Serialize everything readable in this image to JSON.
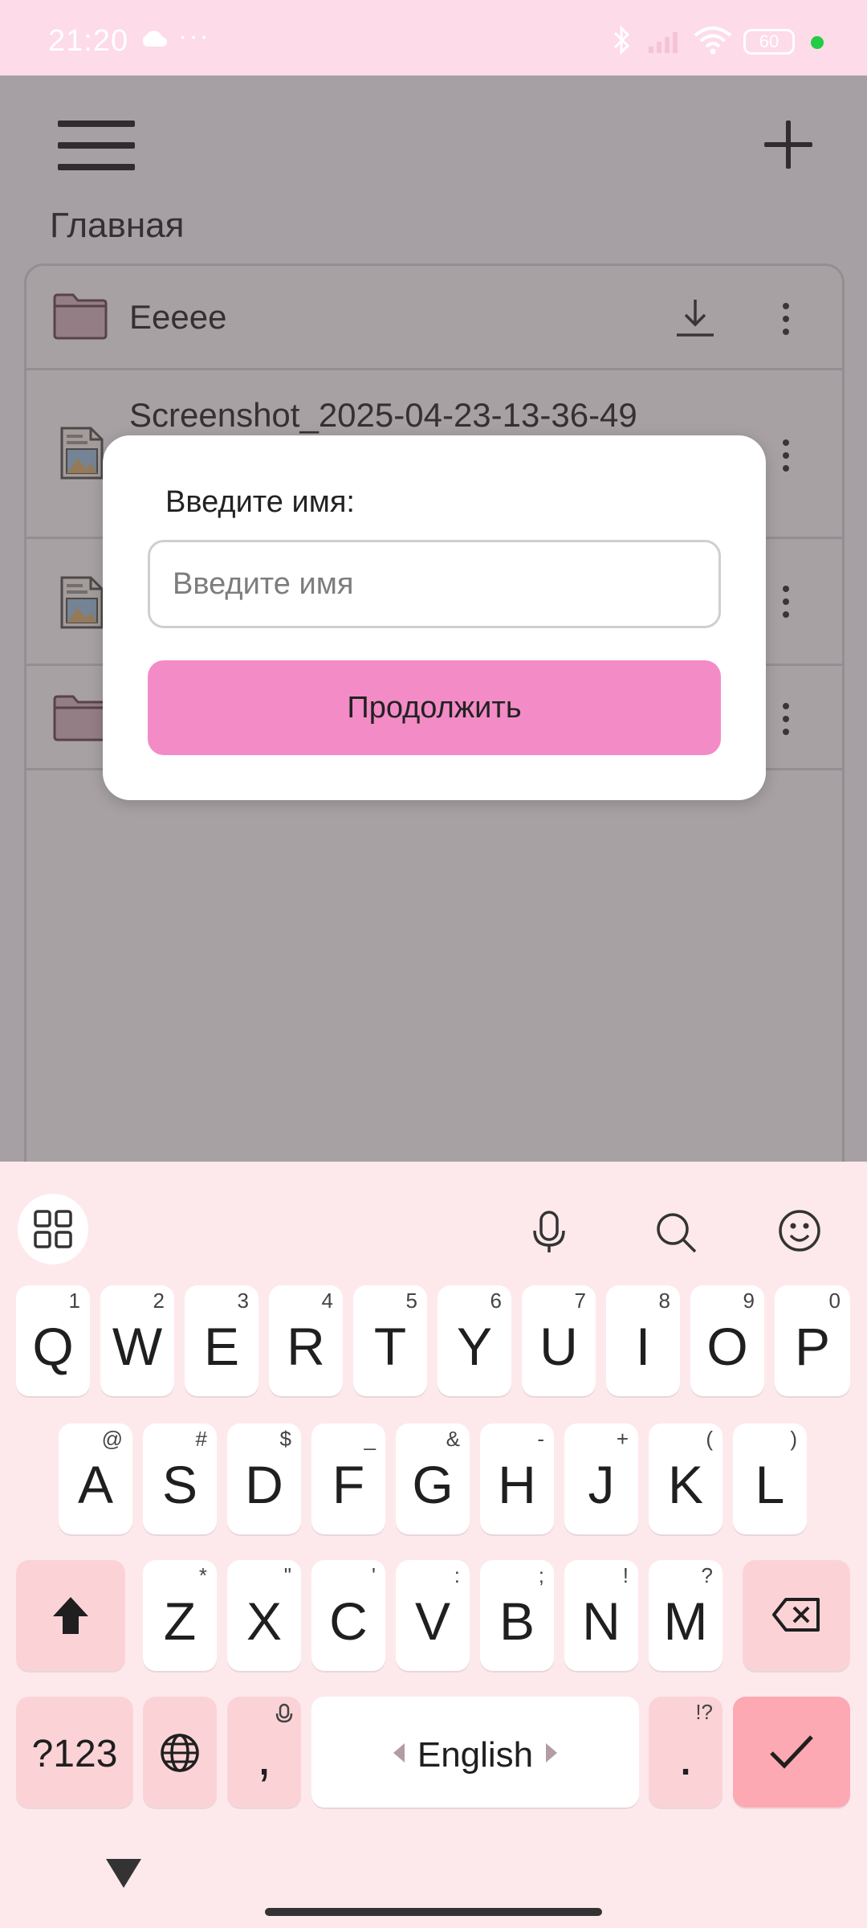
{
  "status_bar": {
    "time": "21:20",
    "overflow": "···",
    "battery": "60",
    "icons": [
      "cloud-icon",
      "bluetooth-icon",
      "signal-icon",
      "wifi-icon",
      "battery-icon"
    ],
    "dot_color": "#22cc44"
  },
  "app": {
    "page_title": "Главная",
    "rows": [
      {
        "name": "Eeeee",
        "type": "folder",
        "download": true
      },
      {
        "name": "Screenshot_2025-04-23-13-36-49",
        "type": "image",
        "download": true
      },
      {
        "name": "",
        "type": "image",
        "download": false
      },
      {
        "name": "",
        "type": "folder",
        "download": false
      }
    ]
  },
  "dialog": {
    "label": "Введите имя:",
    "input_placeholder": "Введите имя",
    "input_value": "",
    "button_label": "Продолжить",
    "button_color": "#f38bc6"
  },
  "keyboard": {
    "row1": [
      {
        "k": "Q",
        "h": "1"
      },
      {
        "k": "W",
        "h": "2"
      },
      {
        "k": "E",
        "h": "3"
      },
      {
        "k": "R",
        "h": "4"
      },
      {
        "k": "T",
        "h": "5"
      },
      {
        "k": "Y",
        "h": "6"
      },
      {
        "k": "U",
        "h": "7"
      },
      {
        "k": "I",
        "h": "8"
      },
      {
        "k": "O",
        "h": "9"
      },
      {
        "k": "P",
        "h": "0"
      }
    ],
    "row2": [
      {
        "k": "A",
        "h": "@"
      },
      {
        "k": "S",
        "h": "#"
      },
      {
        "k": "D",
        "h": "$"
      },
      {
        "k": "F",
        "h": "_"
      },
      {
        "k": "G",
        "h": "&"
      },
      {
        "k": "H",
        "h": "-"
      },
      {
        "k": "J",
        "h": "+"
      },
      {
        "k": "K",
        "h": "("
      },
      {
        "k": "L",
        "h": ")"
      }
    ],
    "row3": [
      {
        "k": "Z",
        "h": "*"
      },
      {
        "k": "X",
        "h": "\""
      },
      {
        "k": "C",
        "h": "'"
      },
      {
        "k": "V",
        "h": ":"
      },
      {
        "k": "B",
        "h": ";"
      },
      {
        "k": "N",
        "h": "!"
      },
      {
        "k": "M",
        "h": "?"
      }
    ],
    "symbols_label": "?123",
    "comma": ",",
    "space_label": "English",
    "period": ".",
    "period_hint": "!?",
    "enter_color": "#fca9b3"
  }
}
